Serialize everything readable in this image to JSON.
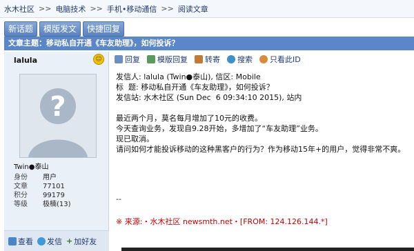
{
  "breadcrumb": {
    "items": [
      "水木社区",
      "电脑技术",
      "手机•移动通信",
      "阅读文章"
    ],
    "sep": ">>"
  },
  "actions": {
    "new_topic": "新话题",
    "template_post": "模版发文",
    "quick_reply": "快捷回复"
  },
  "article": {
    "title": "文章主题：移动私自开通《车友助理》，如何投诉？"
  },
  "user": {
    "username": "lalula",
    "nickname": "Twin●泰山",
    "stats": [
      {
        "k": "身份",
        "v": "用户"
      },
      {
        "k": "文章",
        "v": "77101"
      },
      {
        "k": "积分",
        "v": "99179"
      },
      {
        "k": "等级",
        "v": "极楠(13)"
      }
    ],
    "foot": {
      "view": "查看",
      "message": "发信",
      "friend": "加好友"
    }
  },
  "toolbar": {
    "reply": "回复",
    "template_reply": "模版回复",
    "forward": "转寄",
    "search": "搜索",
    "only_author": "只看此ID"
  },
  "post": {
    "header": [
      "发信人: lalula (Twin●泰山), 信区: Mobile",
      "标  题: 移动私自开通《车友助理》，如何投诉？",
      "发信站: 水木社区 (Sun Dec  6 09:34:10 2015), 站内"
    ],
    "body": [
      "最近两个月，莫名每月增加了10元的收费。",
      "今天查询业务，发现自9.28开始，多增加了“车友助理”业务。",
      "现已取消。",
      "请问如何才能投诉移动的这种黑客户的行为？作为移动15年+的用户，觉得非常不爽。"
    ],
    "sig": "--",
    "source": "※ 来源:・水木社区 newsmth.net・[FROM: 124.126.144.*]"
  },
  "colors": {
    "accent": "#5b86c7",
    "link": "#1f3a6b",
    "source": "#c00000"
  }
}
